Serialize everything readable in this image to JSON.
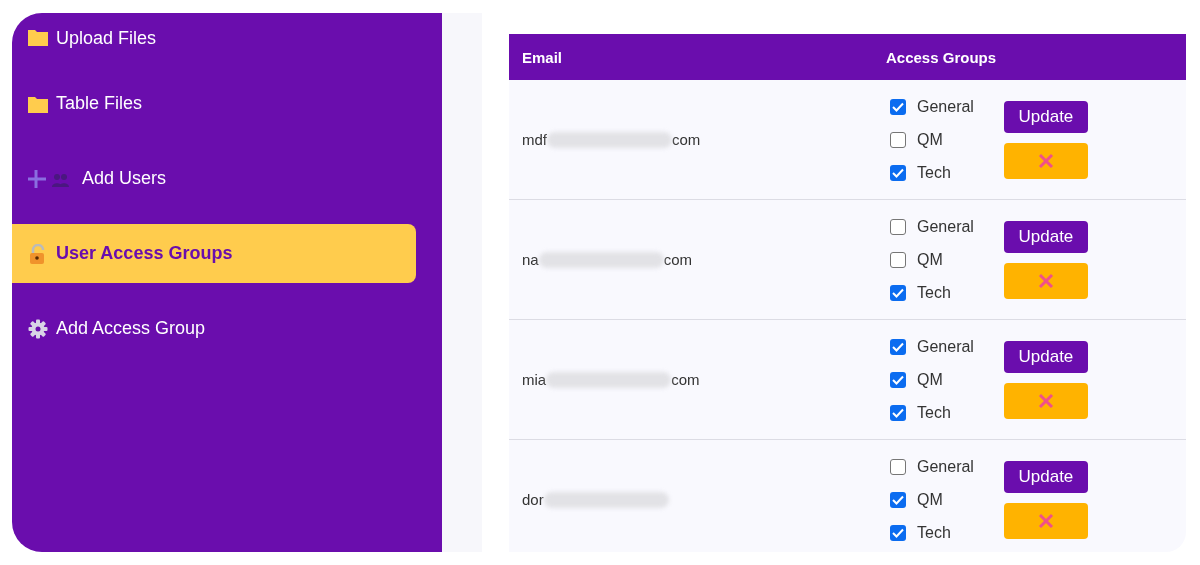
{
  "sidebar": {
    "items": [
      {
        "label": "Upload Files",
        "kind": "folder",
        "selected": false
      },
      {
        "label": "Table Files",
        "kind": "folder",
        "selected": false
      },
      {
        "label": "Add Users",
        "kind": "users",
        "selected": false
      },
      {
        "label": "User Access Groups",
        "kind": "access",
        "selected": true
      },
      {
        "label": "Add Access Group",
        "kind": "settings",
        "selected": false
      }
    ]
  },
  "table": {
    "columns": [
      "Email",
      "Access Groups"
    ],
    "rows": [
      {
        "email_start": "mdf",
        "email_end": "com",
        "groups": [
          {
            "label": "General",
            "checked": true
          },
          {
            "label": "QM",
            "checked": false
          },
          {
            "label": "Tech",
            "checked": true
          }
        ],
        "update": "Update"
      },
      {
        "email_start": "na",
        "email_end": "com",
        "groups": [
          {
            "label": "General",
            "checked": false
          },
          {
            "label": "QM",
            "checked": false
          },
          {
            "label": "Tech",
            "checked": true
          }
        ],
        "update": "Update"
      },
      {
        "email_start": "mia",
        "email_end": "com",
        "groups": [
          {
            "label": "General",
            "checked": true
          },
          {
            "label": "QM",
            "checked": true
          },
          {
            "label": "Tech",
            "checked": true
          }
        ],
        "update": "Update"
      },
      {
        "email_start": "dor",
        "groups": [
          {
            "label": "General",
            "checked": false
          },
          {
            "label": "QM",
            "checked": true
          },
          {
            "label": "Tech",
            "checked": true
          }
        ],
        "update": "Update"
      }
    ]
  }
}
